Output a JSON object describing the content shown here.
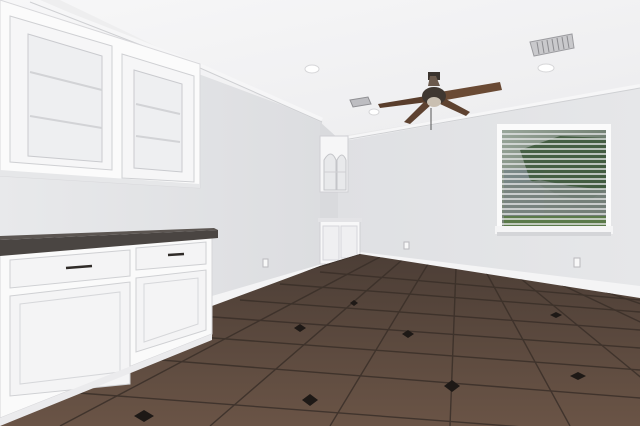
{
  "scene": {
    "kind": "photo",
    "subject": "empty-room-interior",
    "colors": {
      "wall": "#e4e5e7",
      "ceiling": "#f3f3f4",
      "cabinet": "#fbfbfb",
      "counter": "#4a4542",
      "tile": "#5b4a40",
      "grout": "#2f2823",
      "window_glass": "#6d7a6e"
    }
  }
}
